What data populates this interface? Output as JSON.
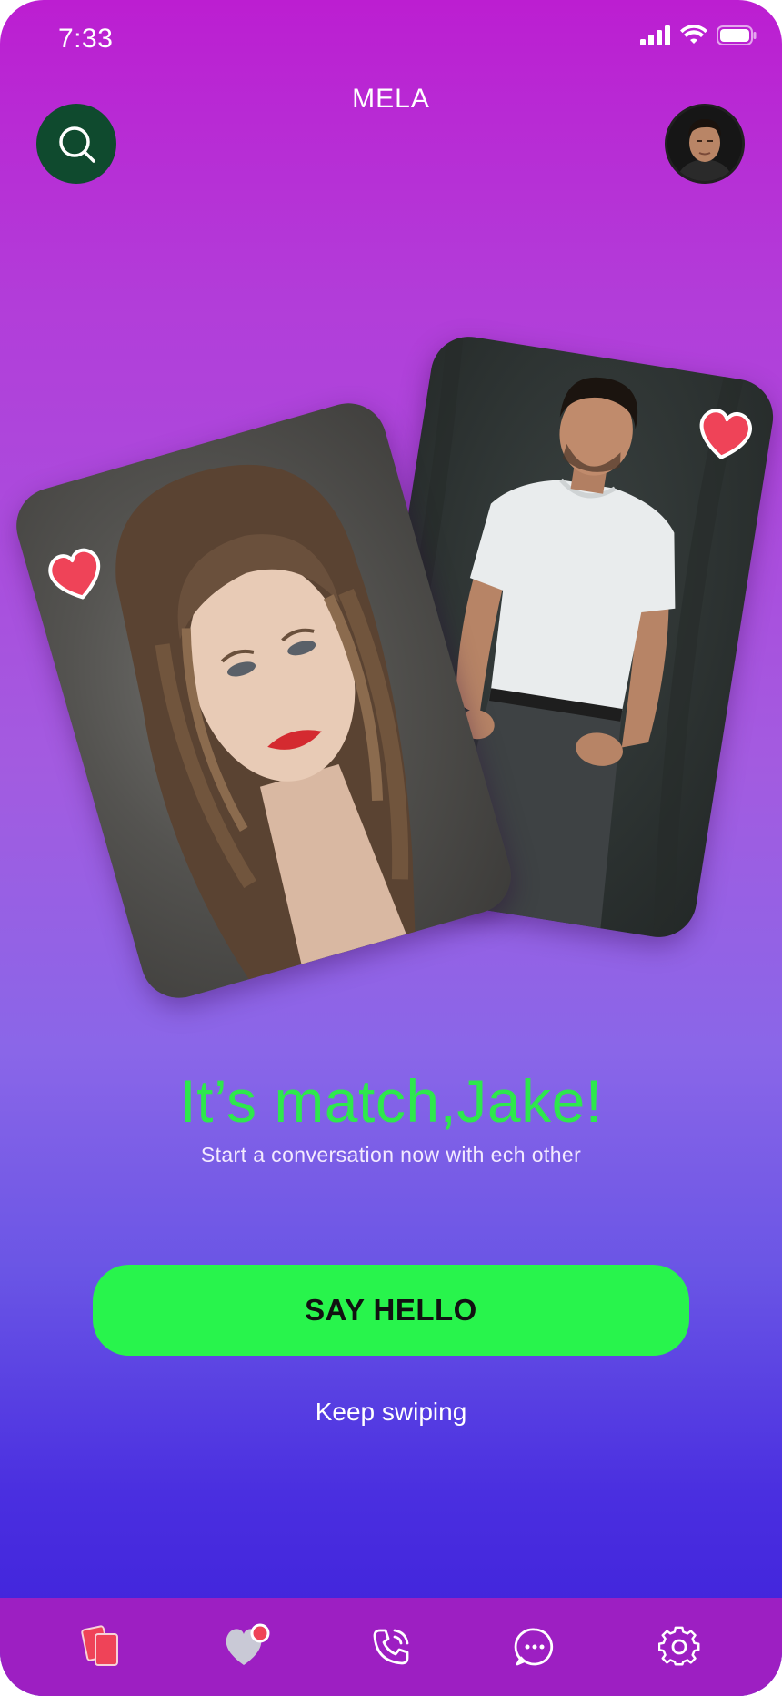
{
  "status_bar": {
    "time": "7:33"
  },
  "header": {
    "logo": "MELA",
    "search_icon": "search-icon",
    "avatar_icon": "profile-avatar"
  },
  "cards": [
    {
      "name": "match-card-woman",
      "heart_icon": "heart-icon",
      "heart_color": "#ef4358"
    },
    {
      "name": "match-card-man",
      "heart_icon": "heart-icon",
      "heart_color": "#ef4358"
    }
  ],
  "match": {
    "title": "It’s match,Jake!",
    "subtitle": "Start a conversation now with ech other"
  },
  "actions": {
    "say_hello": "SAY HELLO",
    "keep_swiping": "Keep swiping"
  },
  "bottom_nav": [
    {
      "icon": "cards-icon",
      "active": true
    },
    {
      "icon": "heart-notification-icon",
      "badge": true
    },
    {
      "icon": "phone-icon"
    },
    {
      "icon": "chat-icon"
    },
    {
      "icon": "settings-icon"
    }
  ],
  "colors": {
    "accent_green": "#28f44c",
    "title_green": "#2ee84c",
    "heart_red": "#ef4358",
    "nav_bg": "#9d1fc2",
    "search_bg": "#0f4a2e"
  }
}
